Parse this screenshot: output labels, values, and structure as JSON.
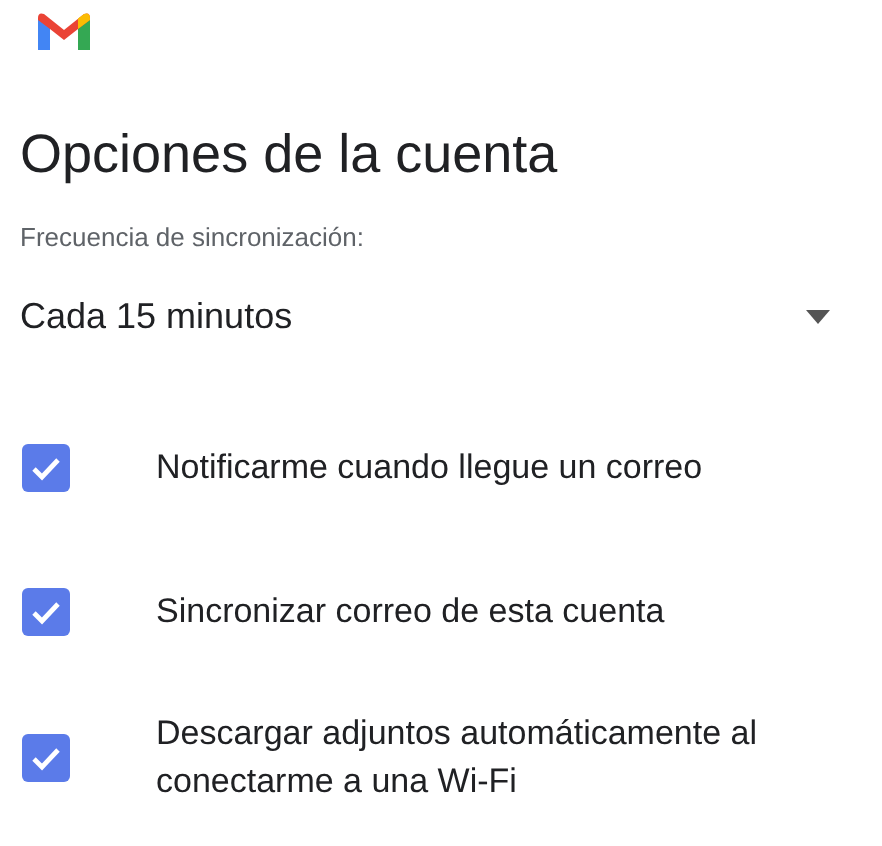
{
  "title": "Opciones de la cuenta",
  "sync": {
    "label": "Frecuencia de sincronización:",
    "value": "Cada 15 minutos"
  },
  "options": [
    {
      "label": "Notificarme cuando llegue un correo",
      "checked": true
    },
    {
      "label": "Sincronizar correo de esta cuenta",
      "checked": true
    },
    {
      "label": "Descargar adjuntos automáticamente al conectarme a una Wi-Fi",
      "checked": true
    }
  ]
}
